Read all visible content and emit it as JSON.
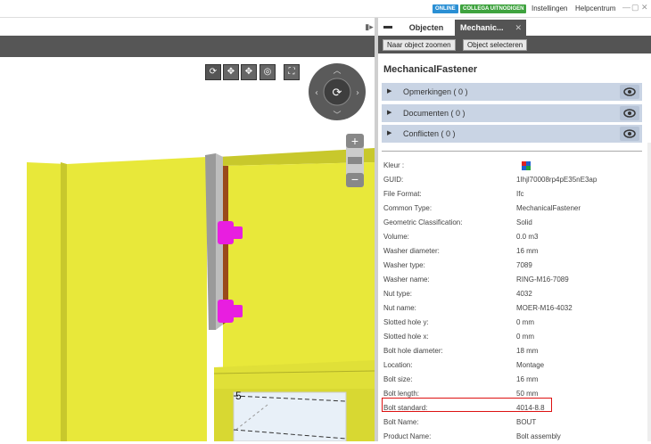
{
  "topbar": {
    "badge_online": "ONLINE",
    "badge_colleague": "COLLEGA UITNODIGEN",
    "settings": "Instellingen",
    "help": "Helpcentrum"
  },
  "tabs": {
    "objecten": "Objecten",
    "active": "Mechanic...",
    "close": "✕"
  },
  "toolbar": {
    "zoom_to_object": "Naar object zoomen",
    "select_object": "Object selecteren"
  },
  "panel": {
    "title": "MechanicalFastener",
    "sections": [
      {
        "label": "Opmerkingen ( 0 )"
      },
      {
        "label": "Documenten ( 0 )"
      },
      {
        "label": "Conflicten ( 0 )"
      }
    ],
    "properties": [
      {
        "key": "Kleur :",
        "value": ""
      },
      {
        "key": "GUID:",
        "value": "1Ihjl70008rp4pE35nE3ap"
      },
      {
        "key": "File Format:",
        "value": "Ifc"
      },
      {
        "key": "Common Type:",
        "value": "MechanicalFastener"
      },
      {
        "key": "Geometric Classification:",
        "value": "Solid"
      },
      {
        "key": "Volume:",
        "value": "0.0 m3"
      },
      {
        "key": "Washer diameter:",
        "value": "16 mm"
      },
      {
        "key": "Washer type:",
        "value": "7089"
      },
      {
        "key": "Washer name:",
        "value": "RING-M16-7089"
      },
      {
        "key": "Nut type:",
        "value": "4032"
      },
      {
        "key": "Nut name:",
        "value": "MOER-M16-4032"
      },
      {
        "key": "Slotted hole y:",
        "value": "0 mm"
      },
      {
        "key": "Slotted hole x:",
        "value": "0 mm"
      },
      {
        "key": "Bolt hole diameter:",
        "value": "18 mm"
      },
      {
        "key": "Location:",
        "value": "Montage"
      },
      {
        "key": "Bolt size:",
        "value": "16 mm"
      },
      {
        "key": "Bolt length:",
        "value": "50 mm"
      },
      {
        "key": "Bolt standard:",
        "value": "4014-8.8"
      },
      {
        "key": "Bolt Name:",
        "value": "BOUT"
      },
      {
        "key": "Product Name:",
        "value": "Bolt assembly"
      }
    ]
  },
  "viewport": {
    "label": "5"
  },
  "colors": {
    "steel_yellow": "#e8e83a",
    "bolt_magenta": "#e81ee0",
    "plate_brown": "#9a4a1a",
    "highlight": "#dd1111"
  }
}
